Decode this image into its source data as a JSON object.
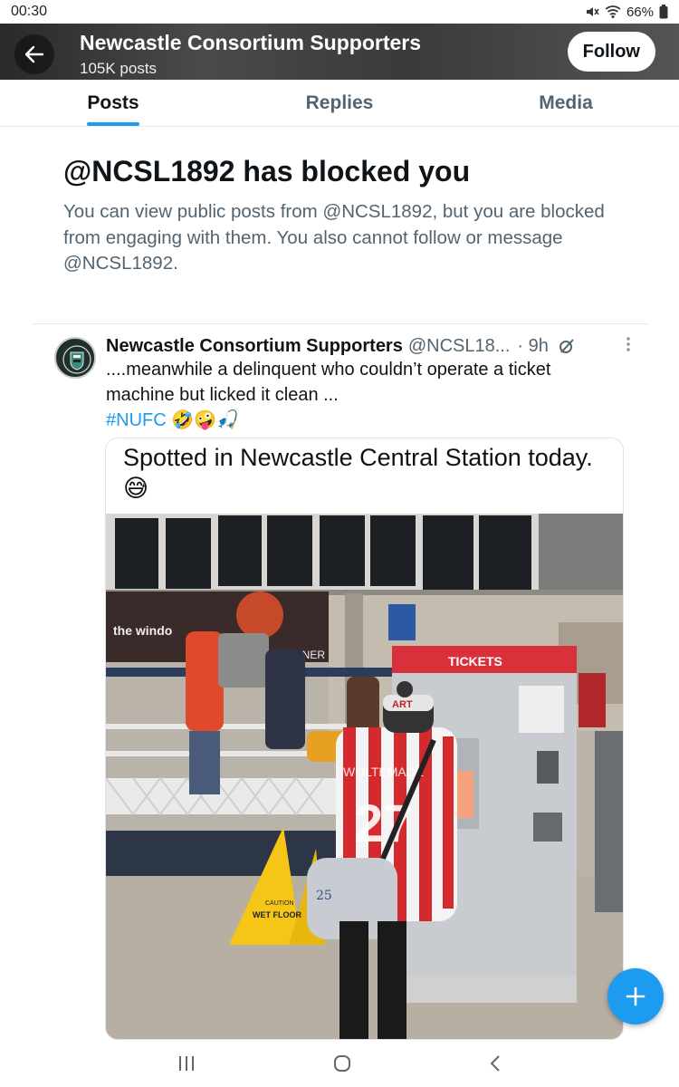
{
  "status_bar": {
    "time": "00:30",
    "battery": "66%",
    "icons": [
      "mute-icon",
      "wifi-icon",
      "battery-icon"
    ]
  },
  "header": {
    "title": "Newcastle Consortium Supporters",
    "subtitle": "105K posts",
    "follow_label": "Follow",
    "back_icon": "arrow-left-icon"
  },
  "tabs": [
    {
      "label": "Posts",
      "active": true
    },
    {
      "label": "Replies",
      "active": false
    },
    {
      "label": "Media",
      "active": false
    }
  ],
  "blocked_notice": {
    "heading": "@NCSL1892 has blocked you",
    "body": "You can view public posts from @NCSL1892, but you are blocked from engaging with them. You also cannot follow or message @NCSL1892."
  },
  "tweet": {
    "name": "Newcastle Consortium Supporters",
    "handle": "@NCSL18...",
    "time": "· 9h",
    "text": "....meanwhile  a delinquent who couldn’t operate a ticket machine  but licked it clean  ...",
    "hashtag": "#NUFC",
    "emojis": "🤣🤪🎣",
    "quote": {
      "text": "Spotted in Newcastle Central Station today.",
      "emoji": "😅"
    },
    "photo_signs": {
      "tickets": "TICKETS",
      "wet_floor": "WET FLOOR",
      "caution": "CAUTION",
      "banner": "the windo",
      "lner": "LNER",
      "shirt_number": "27",
      "shirt_name": "WOLTEMADE",
      "hat_text": "ART",
      "bag_number": "25"
    }
  },
  "colors": {
    "accent": "#1d9bf0",
    "text_primary": "#0f1419",
    "text_secondary": "#536471"
  },
  "nav": {
    "recent_icon": "recent-apps-icon",
    "home_icon": "home-icon",
    "back_icon": "back-nav-icon"
  }
}
